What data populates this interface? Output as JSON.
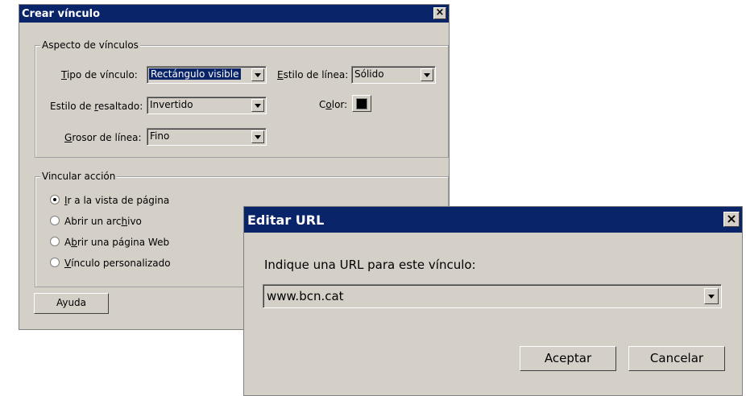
{
  "crear": {
    "title": "Crear vínculo",
    "close": "×",
    "aspecto": {
      "title": "Aspecto de vínculos",
      "tipo_label": "Tipo de vínculo:",
      "tipo_value": "Rectángulo visible",
      "estilo_linea_label": "Estilo de línea:",
      "estilo_linea_value": "Sólido",
      "resaltado_label": "Estilo de resaltado:",
      "resaltado_value": "Invertido",
      "color_label": "Color:",
      "color_value": "#000000",
      "grosor_label": "Grosor de línea:",
      "grosor_value": "Fino"
    },
    "accion": {
      "title": "Vincular acción",
      "options": [
        {
          "label": "Ir a la vista de página",
          "selected": true
        },
        {
          "label": "Abrir un archivo",
          "selected": false
        },
        {
          "label": "Abrir una página Web",
          "selected": false
        },
        {
          "label": "Vínculo personalizado",
          "selected": false
        }
      ]
    },
    "ayuda": "Ayuda"
  },
  "editar": {
    "title": "Editar URL",
    "close": "×",
    "prompt": "Indique una URL para este vínculo:",
    "url_value": "www.bcn.cat",
    "aceptar": "Aceptar",
    "cancelar": "Cancelar"
  },
  "colors": {
    "title_bar": "#0a246a",
    "dialog_bg": "#d4d0c8"
  }
}
